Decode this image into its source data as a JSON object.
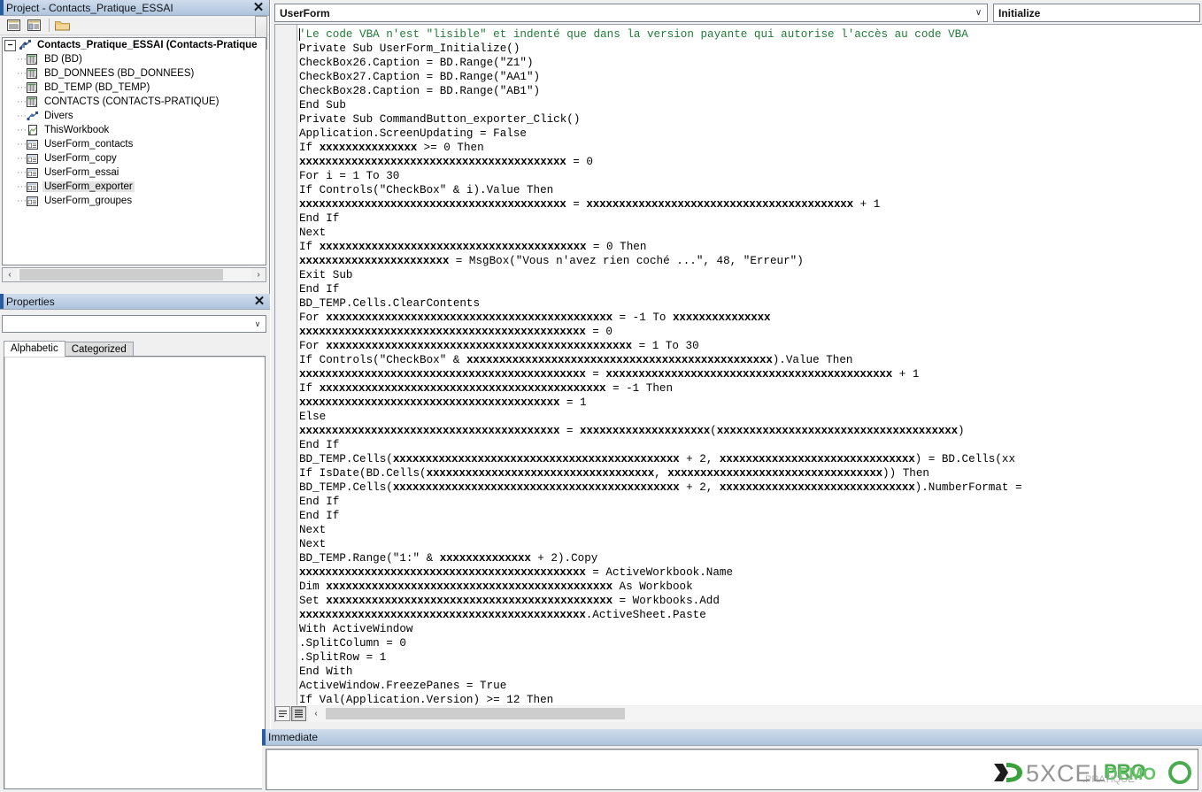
{
  "project_panel": {
    "title": "Project - Contacts_Pratique_ESSAI",
    "close_label": "✕",
    "toolbar": {
      "view_code_icon": "view-code-icon",
      "view_object_icon": "view-object-icon",
      "toggle_folders_icon": "folder-icon",
      "overflow_label": "▼"
    },
    "tree": {
      "expander": "−",
      "root": {
        "label": "Contacts_Pratique_ESSAI (Contacts-Pratique",
        "icon": "project-icon"
      },
      "items": [
        {
          "label": "BD (BD)",
          "icon": "worksheet-icon",
          "selected": false
        },
        {
          "label": "BD_DONNEES (BD_DONNEES)",
          "icon": "worksheet-icon",
          "selected": false
        },
        {
          "label": "BD_TEMP (BD_TEMP)",
          "icon": "worksheet-icon",
          "selected": false
        },
        {
          "label": "CONTACTS (CONTACTS-PRATIQUE)",
          "icon": "worksheet-icon",
          "selected": false
        },
        {
          "label": "Divers",
          "icon": "module-icon",
          "selected": false
        },
        {
          "label": "ThisWorkbook",
          "icon": "workbook-icon",
          "selected": false
        },
        {
          "label": "UserForm_contacts",
          "icon": "userform-icon",
          "selected": false
        },
        {
          "label": "UserForm_copy",
          "icon": "userform-icon",
          "selected": false
        },
        {
          "label": "UserForm_essai",
          "icon": "userform-icon",
          "selected": false
        },
        {
          "label": "UserForm_exporter",
          "icon": "userform-icon",
          "selected": true
        },
        {
          "label": "UserForm_groupes",
          "icon": "userform-icon",
          "selected": false
        }
      ]
    },
    "hscroll": {
      "left_arrow": "‹",
      "right_arrow": "›"
    }
  },
  "properties_panel": {
    "title": "Properties",
    "close_label": "✕",
    "object_combo_value": "",
    "combo_arrow": "∨",
    "tabs": [
      {
        "label": "Alphabetic",
        "active": true
      },
      {
        "label": "Categorized",
        "active": false
      }
    ]
  },
  "code_window": {
    "object_combo": {
      "value": "UserForm",
      "arrow": "∨"
    },
    "procedure_combo": {
      "value": "Initialize",
      "arrow": "∨"
    },
    "bottom_bar": {
      "procedure_view_icon": "procedure-view-icon",
      "full_module_view_icon": "full-module-view-icon",
      "hscroll_left_arrow": "‹"
    },
    "lines": [
      {
        "t": "comment",
        "s": "'Le code VBA n'est \"lisible\" et indenté que dans la version payante qui autorise l'accès au code VBA"
      },
      {
        "t": "code",
        "s": "Private Sub UserForm_Initialize()"
      },
      {
        "t": "code",
        "s": "CheckBox26.Caption = BD.Range(\"Z1\")"
      },
      {
        "t": "code",
        "s": "CheckBox27.Caption = BD.Range(\"AA1\")"
      },
      {
        "t": "code",
        "s": "CheckBox28.Caption = BD.Range(\"AB1\")"
      },
      {
        "t": "code",
        "s": "End Sub"
      },
      {
        "t": "code",
        "s": "Private Sub CommandButton_exporter_Click()"
      },
      {
        "t": "code",
        "s": "Application.ScreenUpdating = False"
      },
      {
        "t": "code",
        "s": "If xxxxxxxxxxxxxxx >= 0 Then"
      },
      {
        "t": "code",
        "s": "xxxxxxxxxxxxxxxxxxxxxxxxxxxxxxxxxxxxxxxxx = 0"
      },
      {
        "t": "code",
        "s": "For i = 1 To 30"
      },
      {
        "t": "code",
        "s": "If Controls(\"CheckBox\" & i).Value Then"
      },
      {
        "t": "code",
        "s": "xxxxxxxxxxxxxxxxxxxxxxxxxxxxxxxxxxxxxxxxx = xxxxxxxxxxxxxxxxxxxxxxxxxxxxxxxxxxxxxxxxx + 1"
      },
      {
        "t": "code",
        "s": "End If"
      },
      {
        "t": "code",
        "s": "Next"
      },
      {
        "t": "code",
        "s": "If xxxxxxxxxxxxxxxxxxxxxxxxxxxxxxxxxxxxxxxxx = 0 Then"
      },
      {
        "t": "code",
        "s": "xxxxxxxxxxxxxxxxxxxxxxx = MsgBox(\"Vous n'avez rien coché ...\", 48, \"Erreur\")"
      },
      {
        "t": "code",
        "s": "Exit Sub"
      },
      {
        "t": "code",
        "s": "End If"
      },
      {
        "t": "code",
        "s": "BD_TEMP.Cells.ClearContents"
      },
      {
        "t": "code",
        "s": "For xxxxxxxxxxxxxxxxxxxxxxxxxxxxxxxxxxxxxxxxxxxx = -1 To xxxxxxxxxxxxxxx"
      },
      {
        "t": "code",
        "s": "xxxxxxxxxxxxxxxxxxxxxxxxxxxxxxxxxxxxxxxxxxxx = 0"
      },
      {
        "t": "code",
        "s": "For xxxxxxxxxxxxxxxxxxxxxxxxxxxxxxxxxxxxxxxxxxxxxxx = 1 To 30"
      },
      {
        "t": "code",
        "s": "If Controls(\"CheckBox\" & xxxxxxxxxxxxxxxxxxxxxxxxxxxxxxxxxxxxxxxxxxxxxxx).Value Then"
      },
      {
        "t": "code",
        "s": "xxxxxxxxxxxxxxxxxxxxxxxxxxxxxxxxxxxxxxxxxxxx = xxxxxxxxxxxxxxxxxxxxxxxxxxxxxxxxxxxxxxxxxxxx + 1"
      },
      {
        "t": "code",
        "s": "If xxxxxxxxxxxxxxxxxxxxxxxxxxxxxxxxxxxxxxxxxxxx = -1 Then"
      },
      {
        "t": "code",
        "s": "xxxxxxxxxxxxxxxxxxxxxxxxxxxxxxxxxxxxxxxx = 1"
      },
      {
        "t": "code",
        "s": "Else"
      },
      {
        "t": "code",
        "s": "xxxxxxxxxxxxxxxxxxxxxxxxxxxxxxxxxxxxxxxx = xxxxxxxxxxxxxxxxxxxx(xxxxxxxxxxxxxxxxxxxxxxxxxxxxxxxxxxxxx)"
      },
      {
        "t": "code",
        "s": "End If"
      },
      {
        "t": "code",
        "s": "BD_TEMP.Cells(xxxxxxxxxxxxxxxxxxxxxxxxxxxxxxxxxxxxxxxxxxxx + 2, xxxxxxxxxxxxxxxxxxxxxxxxxxxxxx) = BD.Cells(xx"
      },
      {
        "t": "code",
        "s": "If IsDate(BD.Cells(xxxxxxxxxxxxxxxxxxxxxxxxxxxxxxxxxxx, xxxxxxxxxxxxxxxxxxxxxxxxxxxxxxxxx)) Then"
      },
      {
        "t": "code",
        "s": "BD_TEMP.Cells(xxxxxxxxxxxxxxxxxxxxxxxxxxxxxxxxxxxxxxxxxxxx + 2, xxxxxxxxxxxxxxxxxxxxxxxxxxxxxx).NumberFormat ="
      },
      {
        "t": "code",
        "s": "End If"
      },
      {
        "t": "code",
        "s": "End If"
      },
      {
        "t": "code",
        "s": "Next"
      },
      {
        "t": "code",
        "s": "Next"
      },
      {
        "t": "code",
        "s": "BD_TEMP.Range(\"1:\" & xxxxxxxxxxxxxx + 2).Copy"
      },
      {
        "t": "code",
        "s": "xxxxxxxxxxxxxxxxxxxxxxxxxxxxxxxxxxxxxxxxxxxx = ActiveWorkbook.Name"
      },
      {
        "t": "code",
        "s": "Dim xxxxxxxxxxxxxxxxxxxxxxxxxxxxxxxxxxxxxxxxxxxx As Workbook"
      },
      {
        "t": "code",
        "s": "Set xxxxxxxxxxxxxxxxxxxxxxxxxxxxxxxxxxxxxxxxxxxx = Workbooks.Add"
      },
      {
        "t": "code",
        "s": "xxxxxxxxxxxxxxxxxxxxxxxxxxxxxxxxxxxxxxxxxxxx.ActiveSheet.Paste"
      },
      {
        "t": "code",
        "s": "With ActiveWindow"
      },
      {
        "t": "code",
        "s": ".SplitColumn = 0"
      },
      {
        "t": "code",
        "s": ".SplitRow = 1"
      },
      {
        "t": "code",
        "s": "End With"
      },
      {
        "t": "code",
        "s": "ActiveWindow.FreezePanes = True"
      },
      {
        "t": "code",
        "s": "If Val(Application.Version) >= 12 Then"
      }
    ]
  },
  "immediate_window": {
    "title": "Immediate",
    "content": ""
  },
  "watermark": {
    "text": "EXCEL",
    "accent_color": "#3fa535"
  },
  "colors": {
    "comment_green": "#1f7a35",
    "titlebar_blue": "#aec4dd",
    "accent_blue": "#2a5d9e",
    "panel_gray": "#f0f0f0"
  }
}
